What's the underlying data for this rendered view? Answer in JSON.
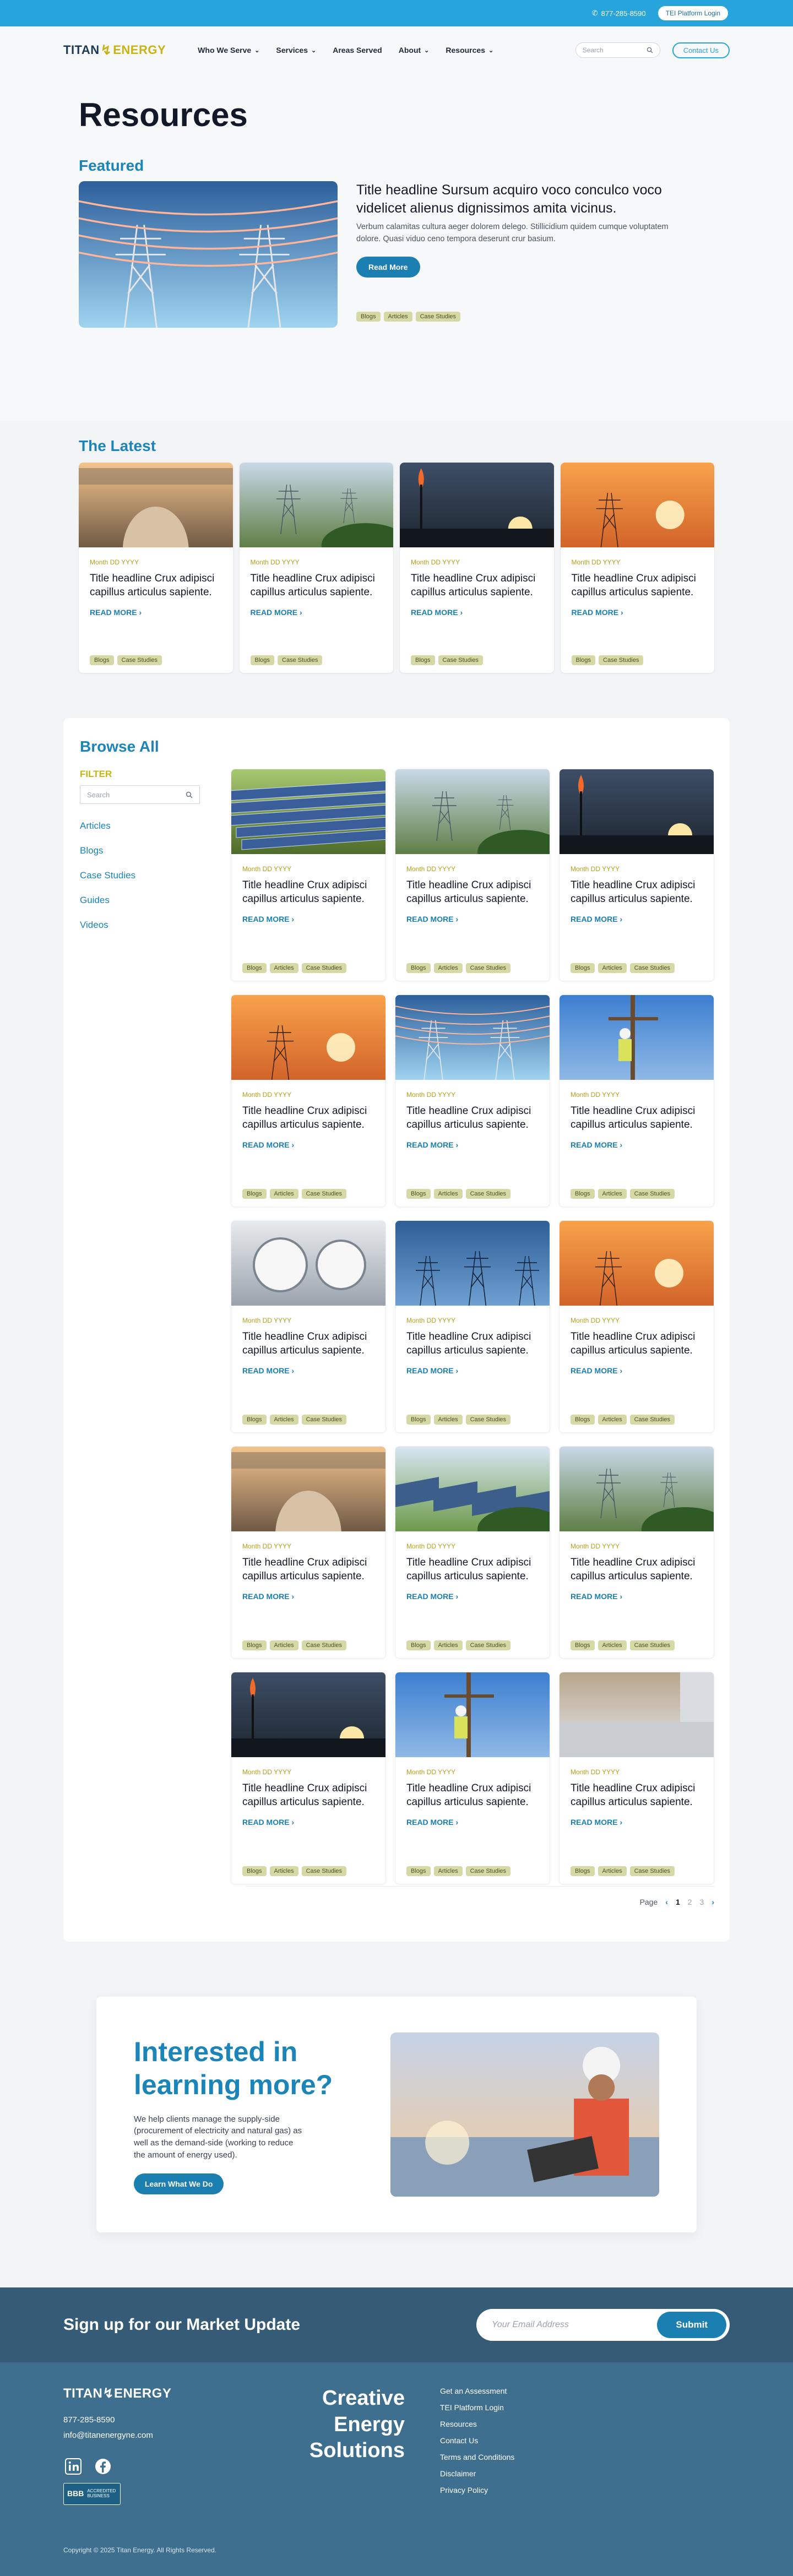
{
  "topbar": {
    "phone": "877-285-8590",
    "platform_login": "TEI Platform Login",
    "colors": {
      "bar": "#27a4dc"
    }
  },
  "header": {
    "logo_first": "TITAN",
    "logo_second": "ENERGY",
    "nav": [
      {
        "label": "Who We Serve",
        "has_dropdown": true
      },
      {
        "label": "Services",
        "has_dropdown": true
      },
      {
        "label": "Areas Served",
        "has_dropdown": false
      },
      {
        "label": "About",
        "has_dropdown": true
      },
      {
        "label": "Resources",
        "has_dropdown": true
      }
    ],
    "search_placeholder": "Search",
    "contact_label": "Contact Us"
  },
  "hero": {
    "title": "Resources",
    "featured_label": "Featured",
    "featured": {
      "title": "Title headline Sursum acquiro voco conculco voco videlicet alienus dignissimos amita vicinus.",
      "excerpt": "Verbum calamitas cultura aeger dolorem delego. Stillicidium quidem cumque voluptatem dolore. Quasi viduo ceno tempora deserunt crur basium.",
      "button": "Read More",
      "tags": [
        "Blogs",
        "Articles",
        "Case Studies"
      ],
      "image": "power-lines"
    }
  },
  "latest": {
    "heading": "The Latest",
    "cards": [
      {
        "image": "pipeline",
        "date": "Month DD YYYY",
        "title": "Title headline Crux adipisci capillus articulus sapiente.",
        "read_more": "READ MORE",
        "tags": [
          "Blogs",
          "Case Studies"
        ]
      },
      {
        "image": "tower-field",
        "date": "Month DD YYYY",
        "title": "Title headline Crux adipisci capillus articulus sapiente.",
        "read_more": "READ MORE",
        "tags": [
          "Blogs",
          "Case Studies"
        ]
      },
      {
        "image": "refinery-flare",
        "date": "Month DD YYYY",
        "title": "Title headline Crux adipisci capillus articulus sapiente.",
        "read_more": "READ MORE",
        "tags": [
          "Blogs",
          "Case Studies"
        ]
      },
      {
        "image": "lineman-sunset",
        "date": "Month DD YYYY",
        "title": "Title headline Crux adipisci capillus articulus sapiente.",
        "read_more": "READ MORE",
        "tags": [
          "Blogs",
          "Case Studies"
        ]
      }
    ]
  },
  "browse": {
    "heading": "Browse All",
    "filter_label": "FILTER",
    "search_placeholder": "Search",
    "categories": [
      "Articles",
      "Blogs",
      "Case Studies",
      "Guides",
      "Videos"
    ],
    "cards": [
      {
        "image": "solar-panels",
        "date": "Month DD YYYY",
        "title": "Title headline Crux adipisci capillus articulus sapiente.",
        "read_more": "READ MORE",
        "tags": [
          "Blogs",
          "Articles",
          "Case Studies"
        ]
      },
      {
        "image": "tower-field",
        "date": "Month DD YYYY",
        "title": "Title headline Crux adipisci capillus articulus sapiente.",
        "read_more": "READ MORE",
        "tags": [
          "Blogs",
          "Articles",
          "Case Studies"
        ]
      },
      {
        "image": "refinery-flare",
        "date": "Month DD YYYY",
        "title": "Title headline Crux adipisci capillus articulus sapiente.",
        "read_more": "READ MORE",
        "tags": [
          "Blogs",
          "Articles",
          "Case Studies"
        ]
      },
      {
        "image": "lineman-sunset",
        "date": "Month DD YYYY",
        "title": "Title headline Crux adipisci capillus articulus sapiente.",
        "read_more": "READ MORE",
        "tags": [
          "Blogs",
          "Articles",
          "Case Studies"
        ]
      },
      {
        "image": "power-lines",
        "date": "Month DD YYYY",
        "title": "Title headline Crux adipisci capillus articulus sapiente.",
        "read_more": "READ MORE",
        "tags": [
          "Blogs",
          "Articles",
          "Case Studies"
        ]
      },
      {
        "image": "lineworkers",
        "date": "Month DD YYYY",
        "title": "Title headline Crux adipisci capillus articulus sapiente.",
        "read_more": "READ MORE",
        "tags": [
          "Blogs",
          "Articles",
          "Case Studies"
        ]
      },
      {
        "image": "meters",
        "date": "Month DD YYYY",
        "title": "Title headline Crux adipisci capillus articulus sapiente.",
        "read_more": "READ MORE",
        "tags": [
          "Blogs",
          "Articles",
          "Case Studies"
        ]
      },
      {
        "image": "towers-dusk",
        "date": "Month DD YYYY",
        "title": "Title headline Crux adipisci capillus articulus sapiente.",
        "read_more": "READ MORE",
        "tags": [
          "Blogs",
          "Articles",
          "Case Studies"
        ]
      },
      {
        "image": "lineman-sunset",
        "date": "Month DD YYYY",
        "title": "Title headline Crux adipisci capillus articulus sapiente.",
        "read_more": "READ MORE",
        "tags": [
          "Blogs",
          "Articles",
          "Case Studies"
        ]
      },
      {
        "image": "pipeline",
        "date": "Month DD YYYY",
        "title": "Title headline Crux adipisci capillus articulus sapiente.",
        "read_more": "READ MORE",
        "tags": [
          "Blogs",
          "Articles",
          "Case Studies"
        ]
      },
      {
        "image": "solar-sheep",
        "date": "Month DD YYYY",
        "title": "Title headline Crux adipisci capillus articulus sapiente.",
        "read_more": "READ MORE",
        "tags": [
          "Blogs",
          "Articles",
          "Case Studies"
        ]
      },
      {
        "image": "tower-field",
        "date": "Month DD YYYY",
        "title": "Title headline Crux adipisci capillus articulus sapiente.",
        "read_more": "READ MORE",
        "tags": [
          "Blogs",
          "Articles",
          "Case Studies"
        ]
      },
      {
        "image": "refinery-flare",
        "date": "Month DD YYYY",
        "title": "Title headline Crux adipisci capillus articulus sapiente.",
        "read_more": "READ MORE",
        "tags": [
          "Blogs",
          "Articles",
          "Case Studies"
        ]
      },
      {
        "image": "lineworkers",
        "date": "Month DD YYYY",
        "title": "Title headline Crux adipisci capillus articulus sapiente.",
        "read_more": "READ MORE",
        "tags": [
          "Blogs",
          "Articles",
          "Case Studies"
        ]
      },
      {
        "image": "ev-charger",
        "date": "Month DD YYYY",
        "title": "Title headline Crux adipisci capillus articulus sapiente.",
        "read_more": "READ MORE",
        "tags": [
          "Blogs",
          "Articles",
          "Case Studies"
        ]
      }
    ],
    "pagination": {
      "label": "Page",
      "current": "1",
      "pages": [
        "2",
        "3"
      ]
    }
  },
  "cta": {
    "title": "Interested in learning more?",
    "text": "We help clients manage the supply-side (procurement of electricity and natural gas) as well as the demand-side (working to reduce the amount of energy used).",
    "button": "Learn What We Do",
    "image": "engineer-laptop"
  },
  "newsletter": {
    "title": "Sign up for our Market Update",
    "email_placeholder": "Your Email Address",
    "submit": "Submit"
  },
  "footer": {
    "logo_first": "TITAN",
    "logo_second": "ENERGY",
    "phone": "877-285-8590",
    "email": "info@titanenergyne.com",
    "socials": [
      "linkedin-icon",
      "facebook-icon"
    ],
    "bbb_label": "ACCREDITED BUSINESS",
    "bbb_seal": "BBB",
    "tagline": "Creative Energy Solutions",
    "links": [
      "Get an Assessment",
      "TEI Platform Login",
      "Resources",
      "Contact Us",
      "Terms and Conditions",
      "Disclaimer",
      "Privacy Policy"
    ],
    "copyright": "Copyright © 2025 Titan Energy. All Rights Reserved."
  },
  "colors": {
    "brand_blue": "#1b84b8",
    "accent_gold": "#c8b414",
    "tag_bg": "#d6d9a6",
    "newsletter_bg": "#355b77",
    "footer_bg": "#3f6f8f"
  }
}
